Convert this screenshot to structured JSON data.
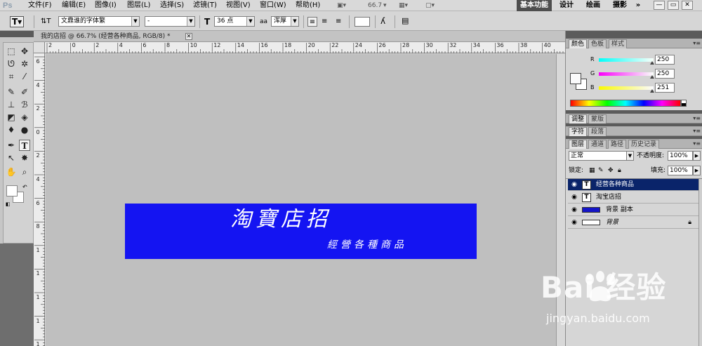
{
  "app": {
    "logo": "Ps",
    "menu": [
      "文件(F)",
      "编辑(E)",
      "图像(I)",
      "图层(L)",
      "选择(S)",
      "滤镜(T)",
      "视图(V)",
      "窗口(W)",
      "帮助(H)"
    ],
    "zoom_label": "66.7",
    "workspaces": [
      "基本功能",
      "设计",
      "绘画",
      "摄影",
      "»"
    ],
    "window_buttons": [
      "—",
      "▭",
      "✕"
    ]
  },
  "options": {
    "font_family": "文鼎谁的字体繁",
    "font_style": "-",
    "font_size": "36 点",
    "antialias_icon": "aa",
    "antialias": "浑厚"
  },
  "document": {
    "tab_title": "我的店招 @ 66.7% (经营各种商品, RGB/8) *",
    "ruler_h_labels": [
      "2",
      "0",
      "2",
      "4",
      "6",
      "8",
      "10",
      "12",
      "14",
      "16",
      "18",
      "20",
      "22",
      "24",
      "26",
      "28",
      "30",
      "32",
      "34",
      "36",
      "38",
      "40"
    ],
    "ruler_v_labels": [
      "6",
      "4",
      "2",
      "0",
      "2",
      "4",
      "6",
      "8",
      "1",
      "1",
      "1",
      "1",
      "1"
    ],
    "banner": {
      "title": "淘寶店招",
      "subtitle": "經營各種商品",
      "color": "#1414f2"
    }
  },
  "panels": {
    "color": {
      "tabs": [
        "颜色",
        "色板",
        "样式"
      ],
      "channels": [
        {
          "label": "R",
          "value": "250",
          "track": "linear-gradient(90deg,#00fffa,#fafffa)",
          "level": 0.98
        },
        {
          "label": "G",
          "value": "250",
          "track": "linear-gradient(90deg,#fa00fa,#fafffa)",
          "level": 0.98
        },
        {
          "label": "B",
          "value": "251",
          "track": "linear-gradient(90deg,#fafa00,#fafaff)",
          "level": 0.98
        }
      ]
    },
    "adjust_tabs": [
      "调整",
      "蒙版"
    ],
    "char_tabs": [
      "字符",
      "段落"
    ],
    "layers": {
      "tabs": [
        "图层",
        "通道",
        "路径",
        "历史记录"
      ],
      "blend_mode": "正常",
      "opacity_label": "不透明度:",
      "opacity": "100%",
      "lock_label": "锁定:",
      "fill_label": "填充:",
      "fill": "100%",
      "items": [
        {
          "name": "经营各种商品",
          "kind": "text",
          "thumb": "T",
          "selected": true
        },
        {
          "name": "淘宝店招",
          "kind": "text",
          "thumb": "T",
          "selected": false
        },
        {
          "name": "背景 副本",
          "kind": "fill",
          "thumb_color": "#1414c8",
          "selected": false
        },
        {
          "name": "背景",
          "kind": "background",
          "thumb_color": "#ffffff",
          "selected": false,
          "locked": true
        }
      ]
    }
  },
  "watermark": {
    "logo": "Bai  经验",
    "url": "jingyan.baidu.com"
  }
}
